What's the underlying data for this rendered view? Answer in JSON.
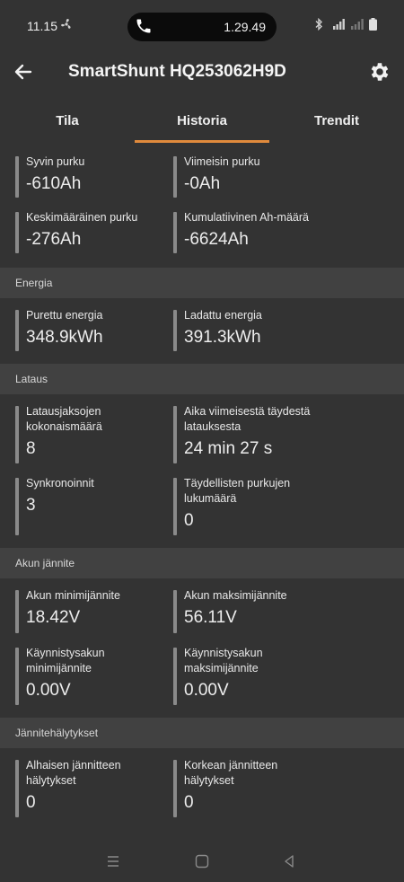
{
  "status_bar": {
    "time": "11.15",
    "call_duration": "1.29.49",
    "network": "5G"
  },
  "app_bar": {
    "title": "SmartShunt HQ253062H9D"
  },
  "tabs": [
    {
      "label": "Tila",
      "selected": false
    },
    {
      "label": "Historia",
      "selected": true
    },
    {
      "label": "Trendit",
      "selected": false
    }
  ],
  "accent_color": "#e08a3c",
  "sections": {
    "top": {
      "items": [
        {
          "label": "Syvin purku",
          "value": "-610Ah"
        },
        {
          "label": "Viimeisin purku",
          "value": "-0Ah"
        },
        {
          "label": "Keskimääräinen purku",
          "value": "-276Ah"
        },
        {
          "label": "Kumulatiivinen Ah-määrä",
          "value": "-6624Ah"
        }
      ]
    },
    "energia": {
      "title": "Energia",
      "items": [
        {
          "label": "Purettu energia",
          "value": "348.9kWh"
        },
        {
          "label": "Ladattu energia",
          "value": "391.3kWh"
        }
      ]
    },
    "lataus": {
      "title": "Lataus",
      "items": [
        {
          "label": "Latausjaksojen kokonaismäärä",
          "value": "8"
        },
        {
          "label": "Aika viimeisestä täydestä latauksesta",
          "value": "24 min 27 s"
        },
        {
          "label": "Synkronoinnit",
          "value": "3"
        },
        {
          "label": "Täydellisten purkujen lukumäärä",
          "value": "0"
        }
      ]
    },
    "akun_jannite": {
      "title": "Akun jännite",
      "items": [
        {
          "label": "Akun minimijännite",
          "value": "18.42V"
        },
        {
          "label": "Akun maksimijännite",
          "value": "56.11V"
        },
        {
          "label": "Käynnistysakun minimijännite",
          "value": "0.00V"
        },
        {
          "label": "Käynnistysakun maksimijännite",
          "value": "0.00V"
        }
      ]
    },
    "jannitehalytykset": {
      "title": "Jännitehälytykset",
      "items": [
        {
          "label": "Alhaisen jännitteen hälytykset",
          "value": "0"
        },
        {
          "label": "Korkean jännitteen hälytykset",
          "value": "0"
        }
      ]
    }
  }
}
